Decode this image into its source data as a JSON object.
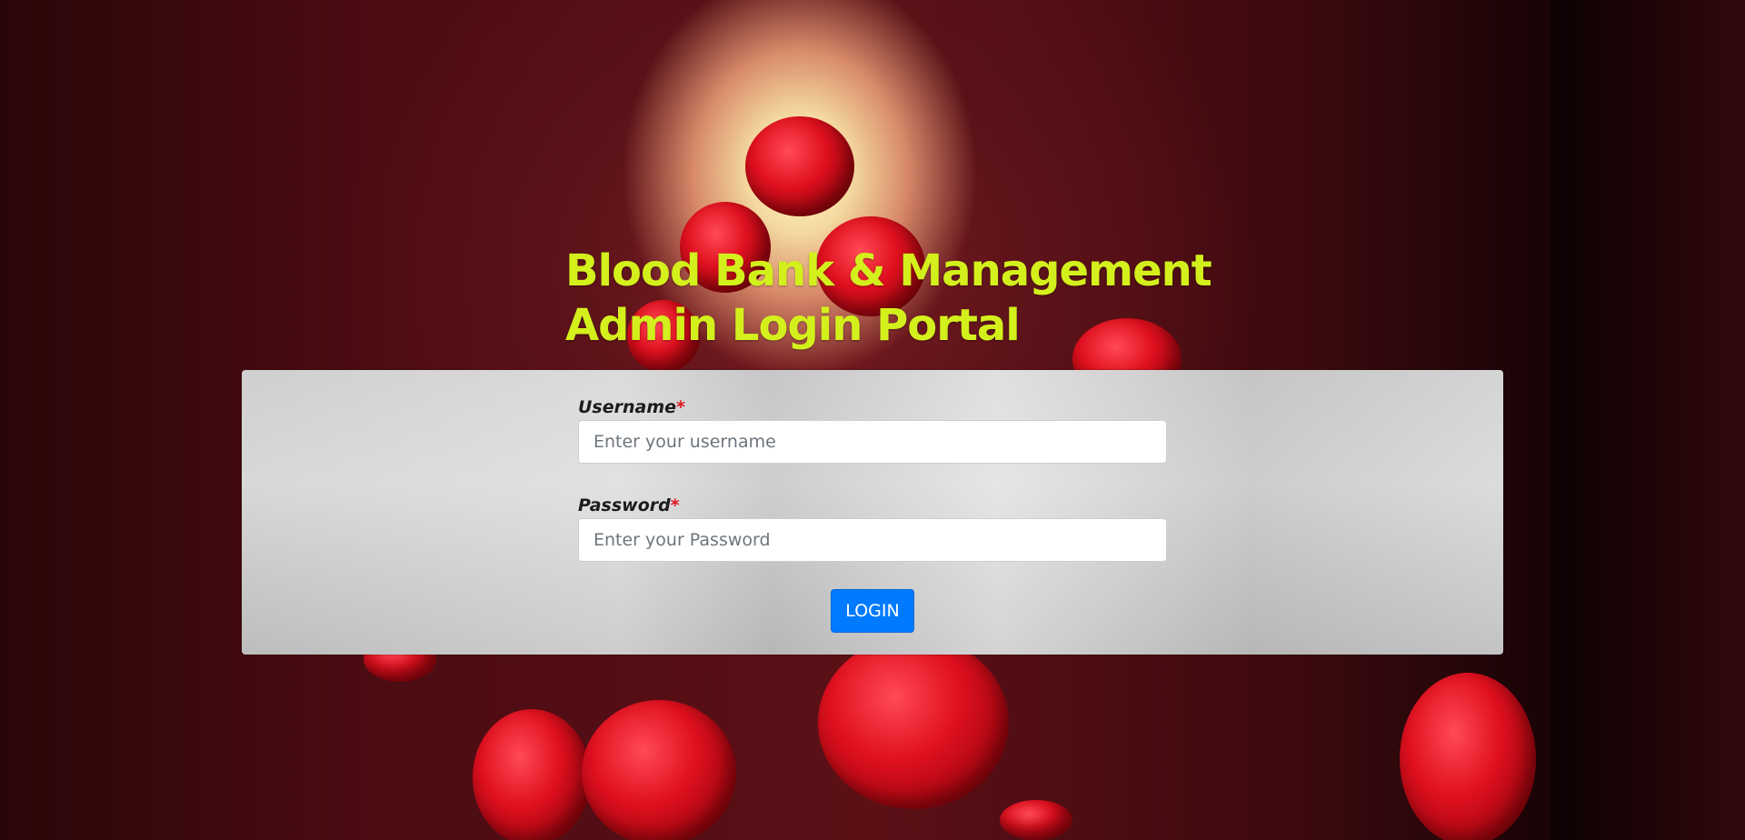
{
  "header": {
    "title_line1": "Blood Bank & Management",
    "title_line2": "Admin Login Portal"
  },
  "form": {
    "username": {
      "label": "Username",
      "required_mark": "*",
      "placeholder": "Enter your username",
      "value": ""
    },
    "password": {
      "label": "Password",
      "required_mark": "*",
      "placeholder": "Enter your Password",
      "value": ""
    },
    "login_label": "LOGIN"
  },
  "colors": {
    "title": "#d4f01c",
    "required": "#e0151f",
    "button": "#007bff"
  }
}
